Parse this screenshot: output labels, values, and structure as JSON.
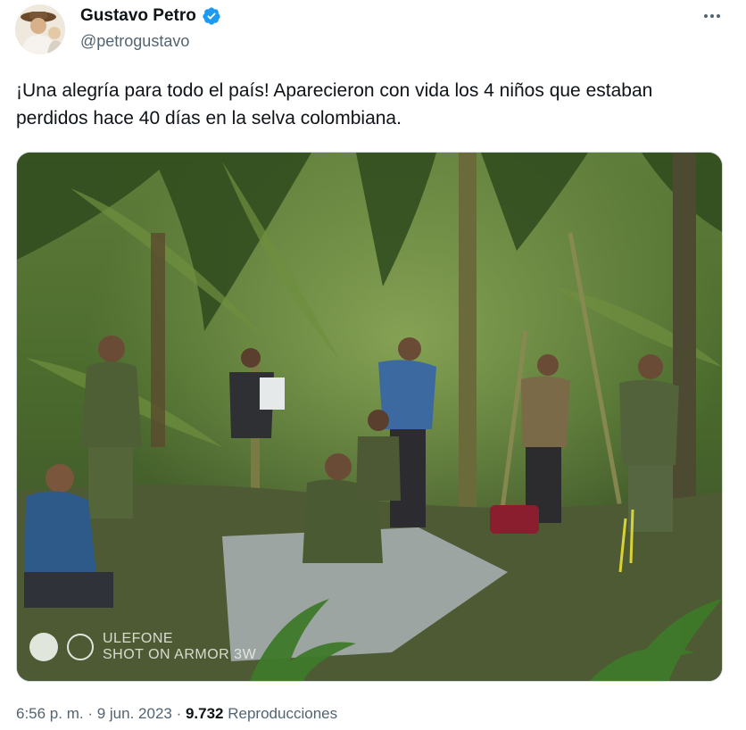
{
  "author": {
    "display_name": "Gustavo Petro",
    "handle": "@petrogustavo",
    "verified_color": "#1d9bf0"
  },
  "tweet": {
    "text": "¡Una alegría para todo el país! Aparecieron con vida los 4 niños que estaban perdidos hace 40 días en la selva colombiana."
  },
  "media": {
    "watermark_line1": "ULEFONE",
    "watermark_line2": "SHOT ON ARMOR 3W"
  },
  "meta": {
    "time": "6:56 p. m.",
    "separator": " · ",
    "date": "9 jun. 2023",
    "views_count": "9.732",
    "views_label": "Reproducciones"
  },
  "icons": {
    "more": "more-options-icon",
    "verified": "verified-badge-icon"
  }
}
